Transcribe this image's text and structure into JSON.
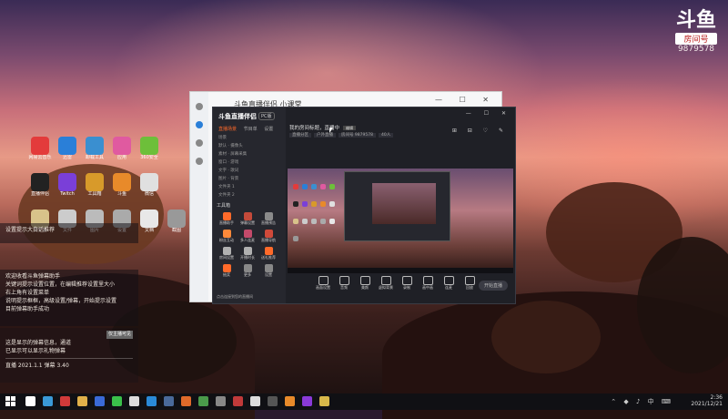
{
  "watermark": {
    "logo": "斗鱼",
    "room_label": "房间号",
    "room_id": "9879578"
  },
  "desktop_icons": [
    {
      "label": "网易云音乐",
      "color": "#e33b3b"
    },
    {
      "label": "迅雷",
      "color": "#2a7fd8"
    },
    {
      "label": "卸载工具",
      "color": "#3a8fd0"
    },
    {
      "label": "应用",
      "color": "#e05aa0"
    },
    {
      "label": "360安全",
      "color": "#6dbf3a"
    },
    {
      "label": "直播伴侣",
      "color": "#222222"
    },
    {
      "label": "Twitch",
      "color": "#7a3fd8"
    },
    {
      "label": "工具箱",
      "color": "#d89a2a"
    },
    {
      "label": "斗鱼",
      "color": "#e88a2a"
    },
    {
      "label": "微信",
      "color": "#e0e0e0"
    },
    {
      "label": "文件夹",
      "color": "#d8c38a"
    },
    {
      "label": "文件",
      "color": "#cccccc"
    },
    {
      "label": "图片",
      "color": "#bbbbbb"
    },
    {
      "label": "设置",
      "color": "#aaaaaa"
    },
    {
      "label": "文档",
      "color": "#e8e8e8"
    },
    {
      "label": "截图",
      "color": "#999999"
    }
  ],
  "chat": {
    "block1": [
      "设置提示大白话推荐"
    ],
    "block2": [
      "欢迎收看斗鱼弹幕助手",
      "关键词提示设置位置，在编辑推荐设置里大小",
      "右上角有设置菜单",
      "说明提示框框，高级设置/弹幕，开始提示设置",
      "目前弹幕助手成功"
    ],
    "tag": "仅主播可见",
    "block3": [
      "这是显示的弹幕信息，通道",
      "已显示可以显示礼物弹幕"
    ],
    "status": "直播 2021.1.1  弹幕 3.40"
  },
  "back_window": {
    "title": "斗鱼直播伴侣 小课堂",
    "controls": "— ☐ ✕"
  },
  "main_window": {
    "logo": "斗鱼直播伴侣",
    "badge": "PC版",
    "tabs": [
      "直播场景",
      "节目单",
      "设置"
    ],
    "scenes": [
      "场景",
      "默认 · 摄像头",
      "素材 · 屏幕采集",
      "窗口 · 游戏",
      "文字 · 歌词",
      "图片 · 背景",
      "文件夹 1",
      "文件夹 2"
    ],
    "tools_header": "工具箱",
    "tools": [
      {
        "label": "直播助手",
        "color": "#ff6a2a"
      },
      {
        "label": "弹幕设置",
        "color": "#c44a3a"
      },
      {
        "label": "直播预告",
        "color": "#8a8a8a"
      },
      {
        "label": "粉丝互动",
        "color": "#ff8a3a"
      },
      {
        "label": "多人连麦",
        "color": "#c44a6a"
      },
      {
        "label": "直播导航",
        "color": "#d04a3a"
      },
      {
        "label": "房间设置",
        "color": "#b0b0b0"
      },
      {
        "label": "开播时长",
        "color": "#b0b0b0"
      },
      {
        "label": "送礼推荐",
        "color": "#ff6a2a"
      },
      {
        "label": "抽奖",
        "color": "#ff6a2a"
      },
      {
        "label": "更多",
        "color": "#888888"
      },
      {
        "label": "设置",
        "color": "#888888"
      }
    ],
    "bottom_note": "点击连接到您的直播间",
    "header_text": "我的房间标题，直播中",
    "header_btn": "编辑",
    "sub_tags": [
      "直播分区",
      "户外直播",
      "房间号 9879578",
      "40人"
    ],
    "controls": "— ☐ ✕",
    "toolbar_icons": "⊞ ⊟ ♡ ✎",
    "bottom_bar": [
      "画面设置",
      "音频",
      "美颜",
      "虚拟背景",
      "录制",
      "画中画",
      "连麦",
      "回放"
    ],
    "golive": "开始直播"
  },
  "taskbar": {
    "time": "2:36",
    "date": "2021/12/21",
    "tray_icons": "⌃ ◆ ♪ 中 ⌨",
    "apps": [
      {
        "name": "search",
        "color": "#ffffff"
      },
      {
        "name": "edge",
        "color": "#3a9ad8"
      },
      {
        "name": "red-app",
        "color": "#d03a3a"
      },
      {
        "name": "folder",
        "color": "#e0b04a"
      },
      {
        "name": "blue-app",
        "color": "#3a6ad8"
      },
      {
        "name": "wechat",
        "color": "#3ac04a"
      },
      {
        "name": "chrome",
        "color": "#dddddd"
      },
      {
        "name": "qq",
        "color": "#2a8ad8"
      },
      {
        "name": "steam",
        "color": "#4a6a9a"
      },
      {
        "name": "app-orange",
        "color": "#e06a2a"
      },
      {
        "name": "app-green",
        "color": "#4a9a4a"
      },
      {
        "name": "app-gray",
        "color": "#888888"
      },
      {
        "name": "app-red",
        "color": "#c03a3a"
      },
      {
        "name": "app-white",
        "color": "#dddddd"
      },
      {
        "name": "app-dark",
        "color": "#555555"
      },
      {
        "name": "douyu",
        "color": "#e88a2a"
      },
      {
        "name": "visual-studio",
        "color": "#8a3ad8"
      },
      {
        "name": "app-yellow",
        "color": "#d8b84a"
      }
    ]
  }
}
